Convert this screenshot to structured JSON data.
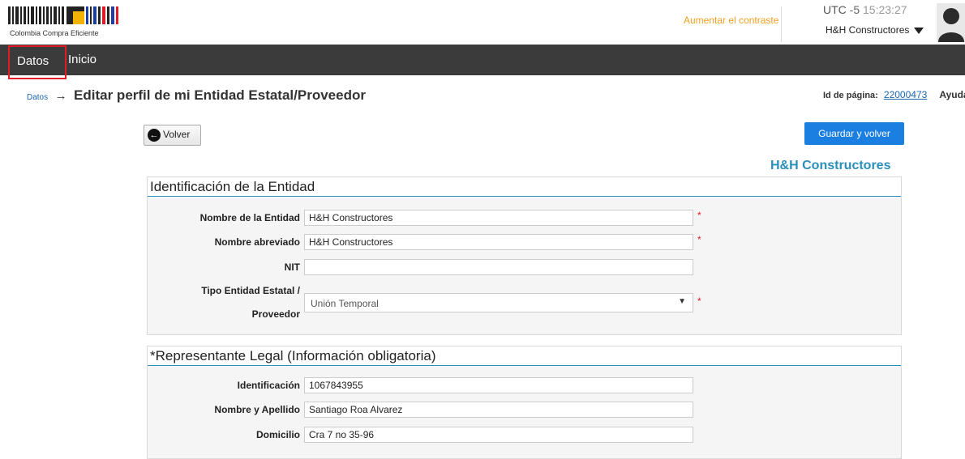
{
  "header": {
    "logo_caption": "Colombia Compra Eficiente",
    "contrast_link": "Aumentar el contraste",
    "utc_label": "UTC",
    "utc_offset": "-5",
    "time": "15:23:27",
    "user_name": "H&H Constructores"
  },
  "nav": {
    "datos": "Datos",
    "inicio": "Inicio"
  },
  "breadcrumb": {
    "crumb": "Datos",
    "arrow": "→",
    "title": "Editar perfil de mi Entidad Estatal/Proveedor"
  },
  "page_info": {
    "id_label": "Id de página:",
    "id_value": "22000473",
    "help": "Ayuda"
  },
  "buttons": {
    "back": "Volver",
    "save": "Guardar y volver"
  },
  "entity_heading": "H&H Constructores",
  "section1": {
    "title": "Identificación de la Entidad",
    "name_label": "Nombre de la Entidad",
    "name_value": "H&H Constructores",
    "short_label": "Nombre abreviado",
    "short_value": "H&H Constructores",
    "nit_label": "NIT",
    "nit_value": "",
    "type_label_1": "Tipo Entidad Estatal /",
    "type_label_2": "Proveedor",
    "type_value": "Unión Temporal"
  },
  "section2": {
    "title": "*Representante Legal (Información obligatoria)",
    "id_label": "Identificación",
    "id_value": "1067843955",
    "fullname_label": "Nombre y Apellido",
    "fullname_value": "Santiago Roa Alvarez",
    "address_label": "Domicilio",
    "address_value": "Cra 7 no 35-96"
  },
  "required_mark": "*",
  "colors": {
    "accent": "#2a8fba",
    "primary_button": "#1a7fe0",
    "nav_bg": "#3b3b3b",
    "contrast_link": "#f0a020",
    "highlight_border": "#e01c24"
  }
}
